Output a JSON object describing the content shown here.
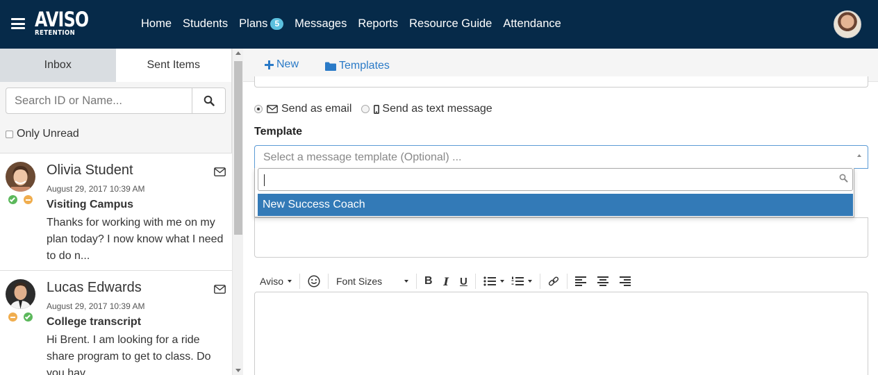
{
  "app": {
    "logo_main": "AVISO",
    "logo_sub": "RETENTION"
  },
  "nav": {
    "items": [
      {
        "label": "Home"
      },
      {
        "label": "Students"
      },
      {
        "label": "Plans",
        "badge": "5"
      },
      {
        "label": "Messages"
      },
      {
        "label": "Reports"
      },
      {
        "label": "Resource Guide"
      },
      {
        "label": "Attendance"
      }
    ]
  },
  "inbox": {
    "tabs": [
      {
        "label": "Inbox",
        "active": true
      },
      {
        "label": "Sent Items",
        "active": false
      }
    ],
    "search_placeholder": "Search ID or Name...",
    "only_unread_label": "Only Unread",
    "messages": [
      {
        "name": "Olivia Student",
        "date": "August 29, 2017 10:39 AM",
        "subject": "Visiting Campus",
        "preview": "Thanks for working with me on my plan today? I now know what I need to do n...",
        "status": [
          "green",
          "orange"
        ]
      },
      {
        "name": "Lucas Edwards",
        "date": "August 29, 2017 10:39 AM",
        "subject": "College transcript",
        "preview": "Hi Brent. I am looking for a ride share program to get to class. Do you hav...",
        "status": [
          "orange",
          "green"
        ]
      }
    ]
  },
  "compose": {
    "toolbar": {
      "new_label": "New",
      "templates_label": "Templates"
    },
    "send_options": [
      {
        "label": "Send as email",
        "selected": true
      },
      {
        "label": "Send as text message",
        "selected": false
      }
    ],
    "template_label": "Template",
    "template_placeholder": "Select a message template (Optional) ...",
    "dropdown_search_value": "",
    "dropdown_options": [
      "New Success Coach"
    ],
    "editor": {
      "aviso_menu": "Aviso",
      "font_sizes": "Font Sizes"
    }
  },
  "colors": {
    "nav_bg": "#062a49",
    "link": "#2a7ac7",
    "highlight": "#337ab7",
    "badge": "#5bc0de"
  }
}
